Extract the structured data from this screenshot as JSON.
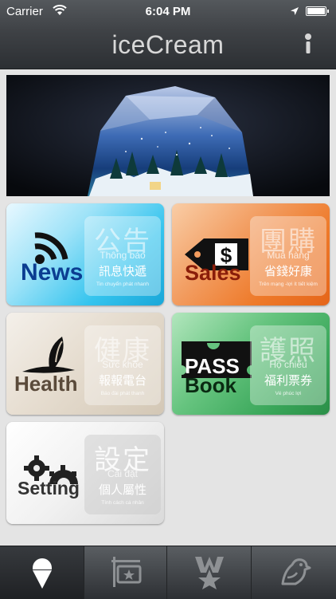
{
  "status_bar": {
    "carrier": "Carrier",
    "time": "6:04 PM",
    "icons": [
      "wifi-icon",
      "location-arrow-icon",
      "battery-icon"
    ]
  },
  "nav": {
    "title": "iceCream",
    "right_icon": "info-icon"
  },
  "banner": {
    "image": "crystal-snow-globe-forest-scene"
  },
  "tiles": [
    {
      "id": "news",
      "logo": "News",
      "title_zh": "公告",
      "subtitle_vi": "Thông báo",
      "label_zh": "訊息快遞",
      "desc_vi": "Tin chuyển phát nhanh",
      "icon": "wifi-signal-icon",
      "color": "#35c4ee"
    },
    {
      "id": "sales",
      "logo": "Sales",
      "title_zh": "團購",
      "subtitle_vi": "Mua hàng",
      "label_zh": "省錢好康",
      "desc_vi": "Trên mạng -lợi ít tiết kiệm",
      "icon": "price-tag-icon",
      "color": "#ee7a2a"
    },
    {
      "id": "health",
      "logo": "Health",
      "title_zh": "健康",
      "subtitle_vi": "Sức khỏe",
      "label_zh": "報報電台",
      "desc_vi": "Báo đài phát thanh",
      "icon": "leaf-figure-icon",
      "color": "#d3c7b5"
    },
    {
      "id": "passbook",
      "logo_top": "PASS",
      "logo_bottom": "Book",
      "title_zh": "護照",
      "subtitle_vi": "Hộ chiếu",
      "label_zh": "福利票券",
      "desc_vi": "Vé phúc lợi",
      "icon": "ticket-icon",
      "color": "#3aa75a"
    },
    {
      "id": "setting",
      "logo": "Setting",
      "title_zh": "設定",
      "subtitle_vi": "Cài đặt",
      "label_zh": "個人屬性",
      "desc_vi": "Tính cách cá nhân",
      "icon": "gears-icon",
      "color": "#dadada"
    }
  ],
  "tabbar": [
    {
      "icon": "ice-cream-icon",
      "selected": true
    },
    {
      "icon": "star-signboard-icon",
      "selected": false
    },
    {
      "icon": "w-star-icon",
      "selected": false
    },
    {
      "icon": "bird-icon",
      "selected": false
    }
  ]
}
